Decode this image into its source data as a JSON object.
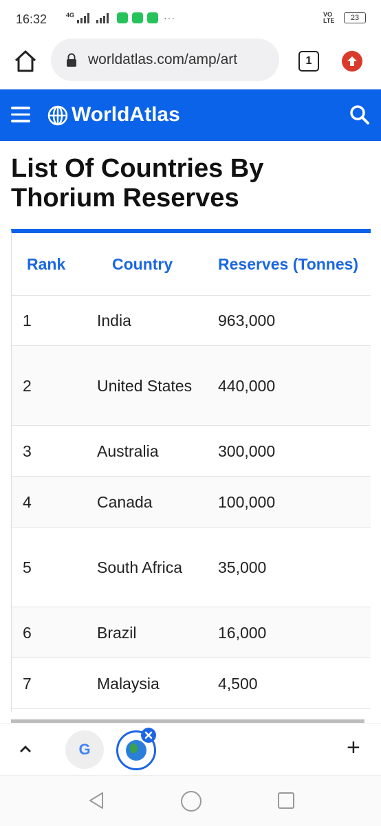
{
  "status_bar": {
    "time": "16:32",
    "network": "4G",
    "volte": "VO LTE",
    "battery": "23"
  },
  "browser": {
    "url": "worldatlas.com/amp/art",
    "tab_count": "1"
  },
  "site": {
    "brand": "WorldAtlas"
  },
  "article": {
    "title": "List Of Countries By Thorium Reserves",
    "table": {
      "headers": [
        "Rank",
        "Country",
        "Reserves (Tonnes)"
      ],
      "rows": [
        [
          "1",
          "India",
          "963,000"
        ],
        [
          "2",
          "United States",
          "440,000"
        ],
        [
          "3",
          "Australia",
          "300,000"
        ],
        [
          "4",
          "Canada",
          "100,000"
        ],
        [
          "5",
          "South Africa",
          "35,000"
        ],
        [
          "6",
          "Brazil",
          "16,000"
        ],
        [
          "7",
          "Malaysia",
          "4,500"
        ]
      ]
    }
  },
  "tab_strip": {
    "google_tab_letter": "G"
  },
  "colors": {
    "accent": "#0a63e8",
    "header_text": "#1b67e0",
    "update_badge": "#d93a2b"
  },
  "icons": [
    "home-icon",
    "lock-icon",
    "tabs-icon",
    "update-icon",
    "menu-icon",
    "globe-icon",
    "search-icon",
    "chevron-up-icon",
    "plus-icon",
    "back-icon",
    "home-circle-icon",
    "recents-icon"
  ]
}
